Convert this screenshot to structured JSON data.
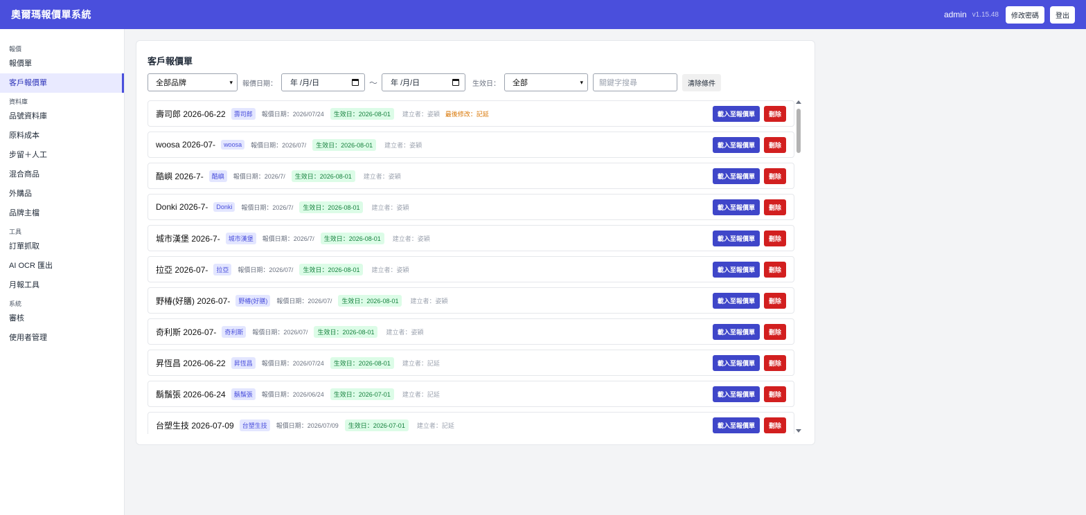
{
  "header": {
    "title": "奧爾瑪報價單系統",
    "user": "admin",
    "version": "v1.15.48",
    "change_password_label": "修改密碼",
    "logout_label": "登出",
    "accent_color": "#4a4fdc"
  },
  "sidebar": {
    "sections": [
      {
        "label": "報價",
        "items": [
          "報價單",
          "客戶報價單"
        ]
      },
      {
        "label": "資料庫",
        "items": [
          "品號資料庫",
          "原料成本",
          "步留＋人工",
          "混合商品",
          "外購品",
          "品牌主檔"
        ]
      },
      {
        "label": "工具",
        "items": [
          "訂單抓取",
          "AI OCR 匯出",
          "月報工具"
        ]
      },
      {
        "label": "系統",
        "items": [
          "審核",
          "使用者管理"
        ]
      }
    ],
    "active_item": "客戶報價單"
  },
  "main": {
    "title": "客戶報價單",
    "filters": {
      "brand_select": "全部品牌",
      "quote_date_label": "報價日期：",
      "date_from": "年 /月/日",
      "date_separator": "～",
      "date_to": "年 /月/日",
      "effective_label": "生效日：",
      "effective_select": "全部",
      "search_placeholder": "關鍵字搜尋",
      "clear_label": "清除條件"
    },
    "load_label": "載入至報價單",
    "delete_label": "刪除",
    "rows": [
      {
        "title": "壽司郎 2026-06-22",
        "brand": "壽司郎",
        "quote_date": "報價日期：2026/07/24",
        "effective": "生效日：2026-08-01",
        "creator": "建立者：姿穎",
        "modified": "最後修改：記延"
      },
      {
        "title": "woosa 2026-07-",
        "brand": "woosa",
        "quote_date": "報價日期：2026/07/",
        "effective": "生效日：2026-08-01",
        "creator": "建立者：姿穎",
        "modified": ""
      },
      {
        "title": "酷嶼 2026-7-",
        "brand": "酷嶼",
        "quote_date": "報價日期：2026/7/",
        "effective": "生效日：2026-08-01",
        "creator": "建立者：姿穎",
        "modified": ""
      },
      {
        "title": "Donki 2026-7-",
        "brand": "Donki",
        "quote_date": "報價日期：2026/7/",
        "effective": "生效日：2026-08-01",
        "creator": "建立者：姿穎",
        "modified": ""
      },
      {
        "title": "城市漢堡 2026-7-",
        "brand": "城市漢堡",
        "quote_date": "報價日期：2026/7/",
        "effective": "生效日：2026-08-01",
        "creator": "建立者：姿穎",
        "modified": ""
      },
      {
        "title": "拉亞 2026-07-",
        "brand": "拉亞",
        "quote_date": "報價日期：2026/07/",
        "effective": "生效日：2026-08-01",
        "creator": "建立者：姿穎",
        "modified": ""
      },
      {
        "title": "野椿(好膳) 2026-07-",
        "brand": "野椿(好膳)",
        "quote_date": "報價日期：2026/07/",
        "effective": "生效日：2026-08-01",
        "creator": "建立者：姿穎",
        "modified": ""
      },
      {
        "title": "奇利斯 2026-07-",
        "brand": "奇利斯",
        "quote_date": "報價日期：2026/07/",
        "effective": "生效日：2026-08-01",
        "creator": "建立者：姿穎",
        "modified": ""
      },
      {
        "title": "昇恆昌 2026-06-22",
        "brand": "昇恆昌",
        "quote_date": "報價日期：2026/07/24",
        "effective": "生效日：2026-08-01",
        "creator": "建立者：記延",
        "modified": ""
      },
      {
        "title": "鬍鬚張 2026-06-24",
        "brand": "鬍鬚張",
        "quote_date": "報價日期：2026/06/24",
        "effective": "生效日：2026-07-01",
        "creator": "建立者：記延",
        "modified": ""
      },
      {
        "title": "台塑生技 2026-07-09",
        "brand": "台塑生技",
        "quote_date": "報價日期：2026/07/09",
        "effective": "生效日：2026-07-01",
        "creator": "建立者：記延",
        "modified": ""
      }
    ]
  }
}
